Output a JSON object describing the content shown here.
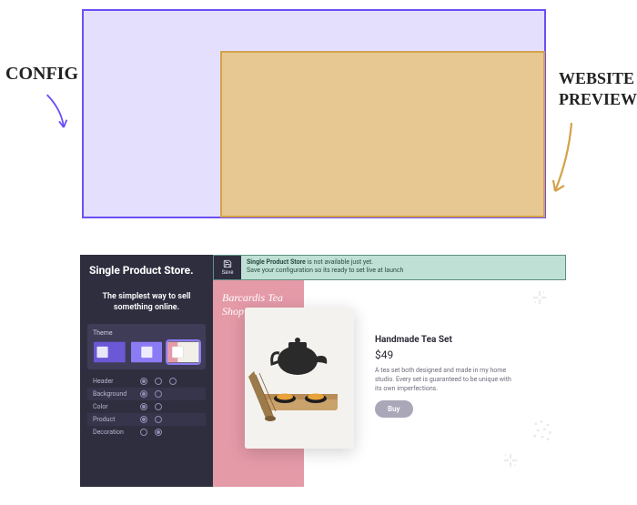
{
  "diagram": {
    "config_label": "CONFIG",
    "preview_label": "WEBSITE PREVIEW",
    "colors": {
      "config_border": "#6c4ff6",
      "config_fill": "#e4dffc",
      "preview_fill": "#e8c892",
      "preview_border": "#d4a24b"
    }
  },
  "config": {
    "logo": "Single Product Store.",
    "tagline": "The simplest way to sell something online.",
    "theme_label": "Theme",
    "themes": [
      {
        "id": "theme-1",
        "selected": false
      },
      {
        "id": "theme-2",
        "selected": false
      },
      {
        "id": "theme-3",
        "selected": true
      }
    ],
    "options": [
      {
        "name": "Header",
        "choices": 3,
        "selected": 0
      },
      {
        "name": "Background",
        "choices": 2,
        "selected": 0
      },
      {
        "name": "Color",
        "choices": 2,
        "selected": 0
      },
      {
        "name": "Product",
        "choices": 2,
        "selected": 0
      },
      {
        "name": "Decoration",
        "choices": 2,
        "selected": 1
      }
    ]
  },
  "banner": {
    "save_label": "Save",
    "line1_strong": "Single Product Store",
    "line1_rest": " is not available just yet.",
    "line2": "Save your configuration so its ready to set live at launch"
  },
  "preview": {
    "shop_name": "Barcardis Tea Shop",
    "product": {
      "title": "Handmade Tea Set",
      "subtitle": "",
      "price": "$49",
      "description": "A tea set both designed and made in my home studio. Every set is guaranteed to be unique with its own imperfections.",
      "buy_label": "Buy"
    }
  }
}
